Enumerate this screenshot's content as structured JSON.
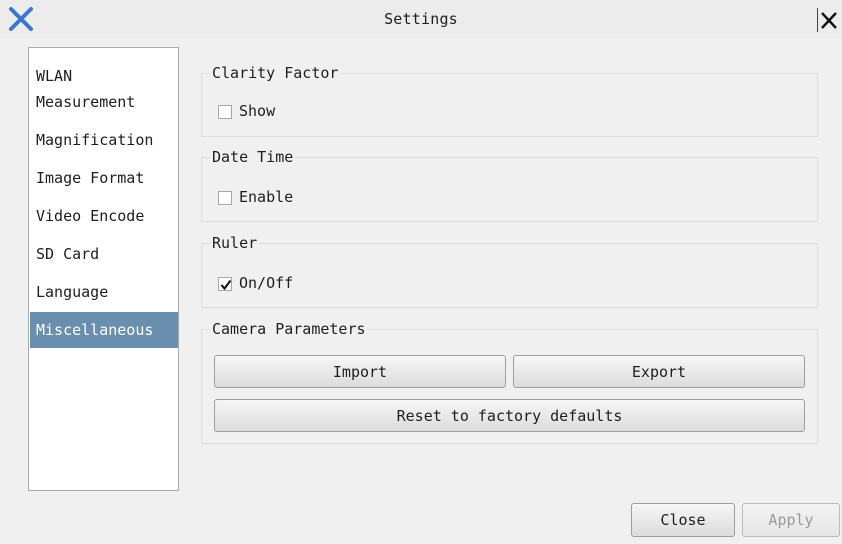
{
  "window": {
    "title": "Settings",
    "app_icon": "x-logo-icon",
    "close_icon": "close-icon"
  },
  "sidebar": {
    "items": [
      {
        "label": "WLAN"
      },
      {
        "label": "Measurement"
      },
      {
        "label": "Magnification"
      },
      {
        "label": "Image Format"
      },
      {
        "label": "Video Encode"
      },
      {
        "label": "SD Card"
      },
      {
        "label": "Language"
      },
      {
        "label": "Miscellaneous",
        "selected": true
      }
    ]
  },
  "groups": {
    "clarity": {
      "title": "Clarity Factor",
      "checkbox_label": "Show",
      "checked": false
    },
    "datetime": {
      "title": "Date Time",
      "checkbox_label": "Enable",
      "checked": false
    },
    "ruler": {
      "title": "Ruler",
      "checkbox_label": "On/Off",
      "checked": true
    },
    "camera": {
      "title": "Camera Parameters",
      "import_label": "Import",
      "export_label": "Export",
      "reset_label": "Reset to factory defaults"
    }
  },
  "footer": {
    "close_label": "Close",
    "apply_label": "Apply",
    "apply_enabled": false
  },
  "colors": {
    "selected_bg": "#6a8fae",
    "icon_blue": "#3a78c9"
  }
}
